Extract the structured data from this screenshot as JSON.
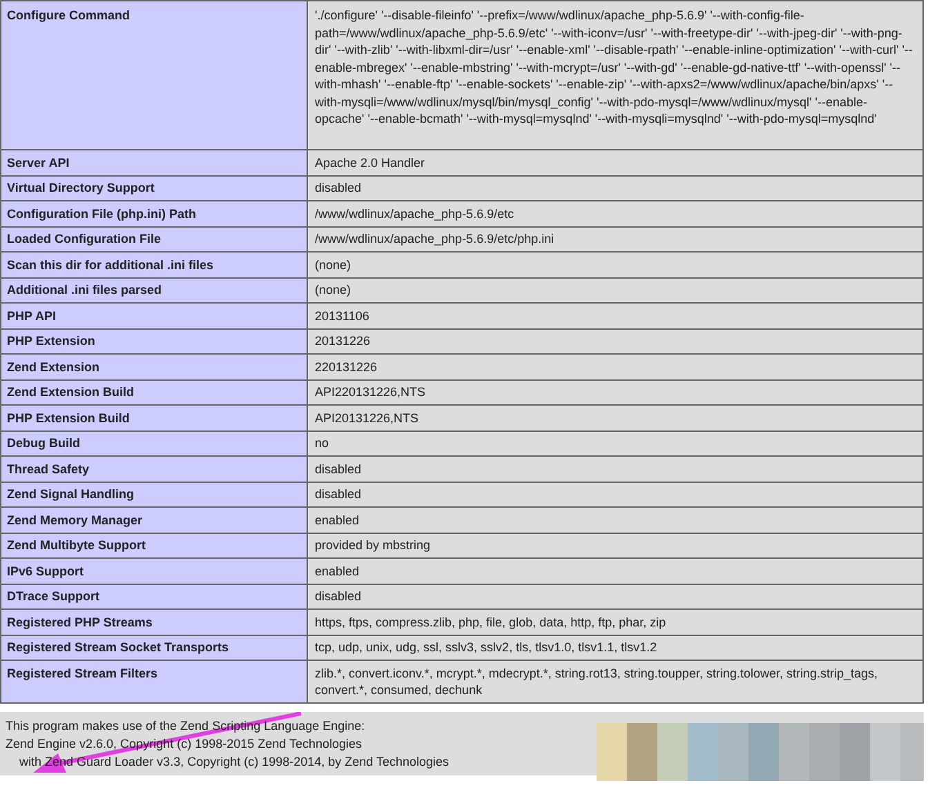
{
  "table": {
    "rows": [
      {
        "label": "Configure Command",
        "value": "'./configure' '--disable-fileinfo' '--prefix=/www/wdlinux/apache_php-5.6.9' '--with-config-file-path=/www/wdlinux/apache_php-5.6.9/etc' '--with-iconv=/usr' '--with-freetype-dir' '--with-jpeg-dir' '--with-png-dir' '--with-zlib' '--with-libxml-dir=/usr' '--enable-xml' '--disable-rpath' '--enable-inline-optimization' '--with-curl' '--enable-mbregex' '--enable-mbstring' '--with-mcrypt=/usr' '--with-gd' '--enable-gd-native-ttf' '--with-openssl' '--with-mhash' '--enable-ftp' '--enable-sockets' '--enable-zip' '--with-apxs2=/www/wdlinux/apache/bin/apxs' '--with-mysqli=/www/wdlinux/mysql/bin/mysql_config' '--with-pdo-mysql=/www/wdlinux/mysql' '--enable-opcache' '--enable-bcmath' '--with-mysql=mysqlnd' '--with-mysqli=mysqlnd' '--with-pdo-mysql=mysqlnd'"
      },
      {
        "label": "Server API",
        "value": "Apache 2.0 Handler"
      },
      {
        "label": "Virtual Directory Support",
        "value": "disabled"
      },
      {
        "label": "Configuration File (php.ini) Path",
        "value": "/www/wdlinux/apache_php-5.6.9/etc"
      },
      {
        "label": "Loaded Configuration File",
        "value": "/www/wdlinux/apache_php-5.6.9/etc/php.ini"
      },
      {
        "label": "Scan this dir for additional .ini files",
        "value": "(none)"
      },
      {
        "label": "Additional .ini files parsed",
        "value": "(none)"
      },
      {
        "label": "PHP API",
        "value": "20131106"
      },
      {
        "label": "PHP Extension",
        "value": "20131226"
      },
      {
        "label": "Zend Extension",
        "value": "220131226"
      },
      {
        "label": "Zend Extension Build",
        "value": "API220131226,NTS"
      },
      {
        "label": "PHP Extension Build",
        "value": "API20131226,NTS"
      },
      {
        "label": "Debug Build",
        "value": "no"
      },
      {
        "label": "Thread Safety",
        "value": "disabled"
      },
      {
        "label": "Zend Signal Handling",
        "value": "disabled"
      },
      {
        "label": "Zend Memory Manager",
        "value": "enabled"
      },
      {
        "label": "Zend Multibyte Support",
        "value": "provided by mbstring"
      },
      {
        "label": "IPv6 Support",
        "value": "enabled"
      },
      {
        "label": "DTrace Support",
        "value": "disabled"
      },
      {
        "label": "Registered PHP Streams",
        "value": "https, ftps, compress.zlib, php, file, glob, data, http, ftp, phar, zip"
      },
      {
        "label": "Registered Stream Socket Transports",
        "value": "tcp, udp, unix, udg, ssl, sslv3, sslv2, tls, tlsv1.0, tlsv1.1, tlsv1.2"
      },
      {
        "label": "Registered Stream Filters",
        "value": "zlib.*, convert.iconv.*, mcrypt.*, mdecrypt.*, string.rot13, string.toupper, string.tolower, string.strip_tags, convert.*, consumed, dechunk"
      }
    ]
  },
  "footer": {
    "lines": [
      "This program makes use of the Zend Scripting Language Engine:",
      "Zend Engine v2.6.0, Copyright (c) 1998-2015 Zend Technologies",
      "    with Zend Guard Loader v3.3, Copyright (c) 1998-2014, by Zend Technologies"
    ]
  }
}
